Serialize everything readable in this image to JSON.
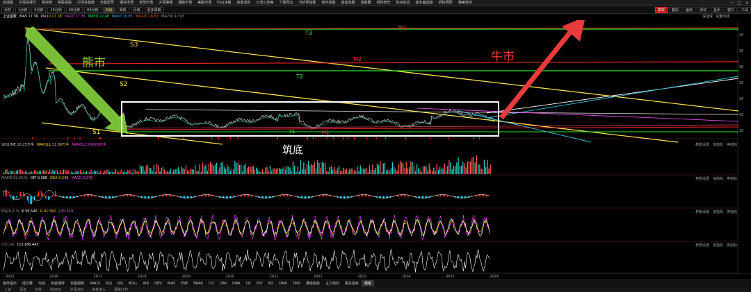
{
  "menubar": {
    "items": [
      "自选股",
      "沪深京排行",
      "板块榜",
      "新股追踪",
      "沪深京指数",
      "全指型号",
      "期货市场",
      "全球市场",
      "沪深港通",
      "港股市场",
      "美股市场",
      "ESG决策",
      "资金流向",
      "公司公告等",
      "个股风云",
      "分析师指数",
      "条件选股",
      "基金选股",
      "选股器",
      "机构增仓",
      "热点追击",
      "基本面选股",
      "机构调研",
      "港美增持"
    ],
    "win_controls": [
      "─",
      "□",
      "✕"
    ]
  },
  "toolbar": {
    "left": [
      "分时",
      "1分钟",
      "5分钟",
      "15分钟",
      "30分钟",
      "60分钟",
      "日线",
      "周线",
      "月线",
      "更多周期"
    ],
    "active_index": 6,
    "right": [
      "复权",
      "叠加",
      "画线",
      "测试",
      "显示",
      "窗口",
      "工具"
    ]
  },
  "info": {
    "name": "上证指数",
    "ma": [
      {
        "label": "MA5 17.39",
        "color": "#ffffff"
      },
      {
        "label": "MA10 17.18",
        "color": "#ffd400"
      },
      {
        "label": "MA20 17.35",
        "color": "#ff44ff"
      },
      {
        "label": "MA30 17.48",
        "color": "#00ff66"
      },
      {
        "label": "MA60 16.85",
        "color": "#4aa8ff"
      },
      {
        "label": "MA120 16.87",
        "color": "#ff6600"
      },
      {
        "label": "MA250 17.63",
        "color": "#aaaaaa"
      }
    ],
    "right_tags": [
      "深证成",
      "设置均线"
    ]
  },
  "annotations": {
    "bear": "熊市",
    "bull": "牛市",
    "bottom": "筑底",
    "S1": "S1",
    "S2": "S2",
    "S3": "S3",
    "T1": "T1",
    "T2": "T2",
    "T3": "T3",
    "M1": "M1",
    "M2": "M2",
    "M3": "M3"
  },
  "panels": {
    "volume": {
      "items": [
        {
          "text": "VOLUME 16.25万手",
          "color": "#cccccc"
        },
        {
          "text": "MAVOL1 11.90万手",
          "color": "#ffd400"
        },
        {
          "text": "MAVOL2 560.69万手",
          "color": "#ff44ff"
        }
      ]
    },
    "macd": {
      "items": [
        {
          "text": "MACD(12,26,9)",
          "color": "#999999"
        },
        {
          "text": "DIF 0.368",
          "color": "#ffffff"
        },
        {
          "text": "DEA 0.239",
          "color": "#ffd400"
        },
        {
          "text": "MACD 0.276",
          "color": "#ff44ff"
        }
      ]
    },
    "kdj": {
      "items": [
        {
          "text": "KDJ(9,3,3)",
          "color": "#999999"
        },
        {
          "text": "K 59.540",
          "color": "#ffffff"
        },
        {
          "text": "D 41.581",
          "color": "#ffd400"
        },
        {
          "text": "J 95.459",
          "color": "#ff44ff"
        }
      ]
    },
    "cci": {
      "items": [
        {
          "text": "CCI(14)",
          "color": "#999999"
        },
        {
          "text": "CCI 166.443",
          "color": "#ffffff"
        }
      ]
    },
    "buttons": [
      "参数设置",
      "加指标",
      "换指标"
    ]
  },
  "years": [
    "2015",
    "2016",
    "2017",
    "2018",
    "2019",
    "2020",
    "2021",
    "2022",
    "2023",
    "2024",
    "2025",
    "2026"
  ],
  "price_scale": [
    "40",
    "35",
    "30",
    "25",
    "20",
    "15",
    "10"
  ],
  "indicator_tabs": [
    "操作提示",
    "成交量",
    "均线",
    "资金博弈",
    "资金趋势",
    "MACD",
    "KDJ",
    "RSI",
    "BOLL",
    "WR",
    "OBV",
    "BIAS",
    "ENE",
    "BRAR",
    "CCI",
    "DMI",
    "DMA",
    "CR",
    "PSY",
    "KD",
    "DMA",
    "TRIX",
    "量能指标",
    "主力动向",
    "更多指标",
    "模板"
  ],
  "indicator_selected_index": 25,
  "statusbar": [
    "上证",
    "深证",
    "创业",
    "科创50",
    "沪深300",
    "资金流入",
    "涨跌分布"
  ]
}
